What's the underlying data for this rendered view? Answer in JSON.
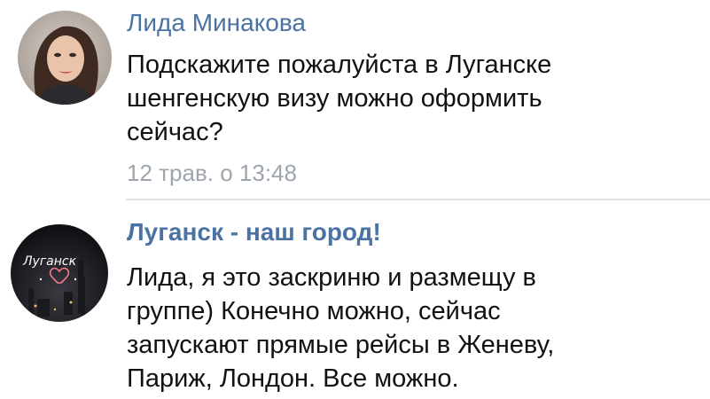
{
  "comments": [
    {
      "author": "Лида Минакова",
      "text_lines": [
        "Подскажите пожалуйста в Луганске",
        "шенгенскую визу можно оформить",
        "сейчас?"
      ],
      "timestamp": "12 трав. о 13:48",
      "avatar_icon": "user-photo"
    },
    {
      "author": "Луганск - наш город!",
      "text_lines": [
        "Лида, я это заскриню и размещу в",
        "группе) Конечно можно, сейчас",
        "запускают прямые рейсы в Женеву,",
        "Париж, Лондон. Все можно."
      ],
      "avatar_icon": "group-logo",
      "avatar_caption": "Луганск"
    }
  ],
  "colors": {
    "author": "#4a73a4",
    "text": "#111111",
    "meta": "#9da5ae",
    "background": "#ffffff"
  }
}
